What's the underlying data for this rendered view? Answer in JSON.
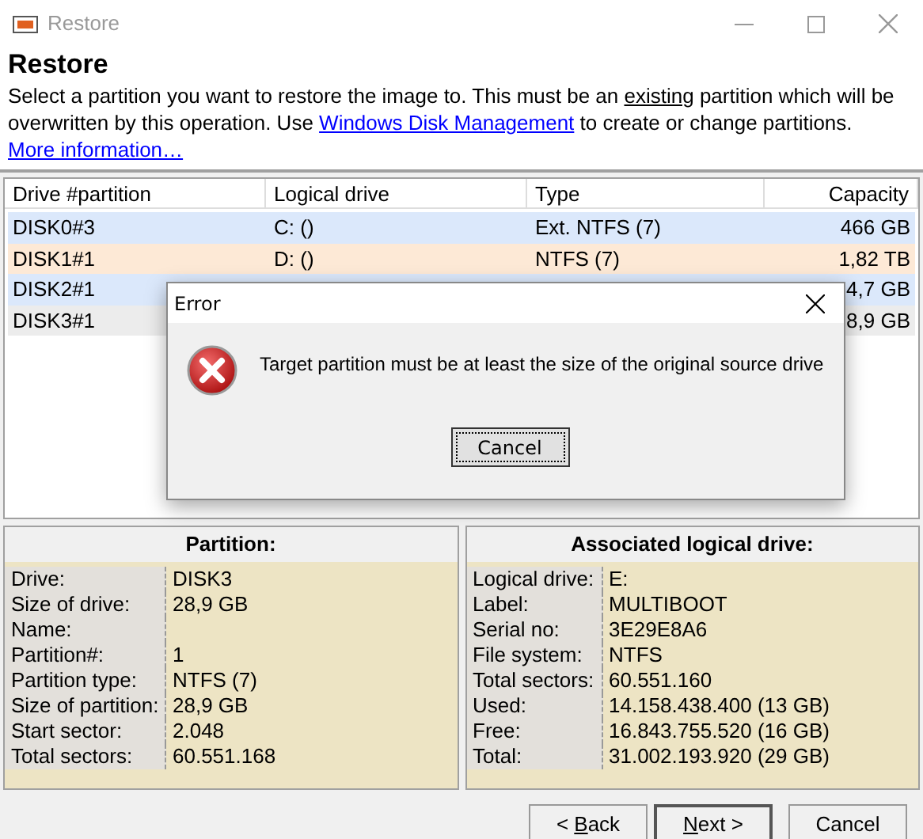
{
  "window": {
    "title": "Restore"
  },
  "header": {
    "title": "Restore",
    "description": [
      {
        "kind": "text",
        "text": "Select a partition you want to restore the image to. This must be an "
      },
      {
        "kind": "underline",
        "text": "existing"
      },
      {
        "kind": "text",
        "text": " partition which will be overwritten by this operation. Use "
      },
      {
        "kind": "link",
        "text": "Windows Disk Management"
      },
      {
        "kind": "text",
        "text": " to create or change partitions. "
      },
      {
        "kind": "link",
        "text": "More information…"
      }
    ]
  },
  "table": {
    "columns": [
      "Drive #partition",
      "Logical drive",
      "Type",
      "Capacity"
    ],
    "rows": [
      {
        "color": "#dbe8fb",
        "cells": [
          "DISK0#3",
          "C: ()",
          "Ext. NTFS (7)",
          "466 GB"
        ]
      },
      {
        "color": "#fde9d6",
        "cells": [
          "DISK1#1",
          "D: ()",
          "NTFS (7)",
          "1,82 TB"
        ]
      },
      {
        "color": "#dbe8fb",
        "cells": [
          "DISK2#1",
          null,
          null,
          "4,7 GB"
        ]
      },
      {
        "color": "#ececec",
        "cells": [
          "DISK3#1",
          null,
          null,
          "8,9 GB"
        ]
      }
    ]
  },
  "partition_panel": {
    "title": "Partition:",
    "fields": [
      {
        "label": "Drive:",
        "value": "DISK3"
      },
      {
        "label": "Size of drive:",
        "value": "28,9 GB"
      },
      {
        "label": "Name:"
      },
      {
        "label": "Partition#:",
        "value": "1"
      },
      {
        "label": "Partition type:",
        "value": "NTFS (7)"
      },
      {
        "label": "Size of partition:",
        "value": "28,9 GB"
      },
      {
        "label": "Start sector:",
        "value": "2.048"
      },
      {
        "label": "Total sectors:",
        "value": "60.551.168"
      }
    ]
  },
  "logical_panel": {
    "title": "Associated logical drive:",
    "fields": [
      {
        "label": "Logical drive:",
        "value": "E:"
      },
      {
        "label": "Label:",
        "value": "MULTIBOOT"
      },
      {
        "label": "Serial no:",
        "value": "3E29E8A6"
      },
      {
        "label": "File system:",
        "value": "NTFS"
      },
      {
        "label": "Total sectors:",
        "value": "60.551.160"
      },
      {
        "label": "Used:",
        "value": "14.158.438.400 (13 GB)"
      },
      {
        "label": "Free:",
        "value": "16.843.755.520 (16 GB)"
      },
      {
        "label": "Total:",
        "value": "31.002.193.920 (29 GB)"
      }
    ]
  },
  "buttons": [
    {
      "pre": "< ",
      "key": "B",
      "post": "ack",
      "default": false
    },
    {
      "key": "N",
      "post": "ext >",
      "default": true
    },
    {
      "pre": "Cancel",
      "default": false
    }
  ],
  "error_dialog": {
    "title": "Error",
    "message": "Target partition must be at least the size of the original source drive",
    "button": {
      "label": "Cancel",
      "focused": true
    }
  }
}
